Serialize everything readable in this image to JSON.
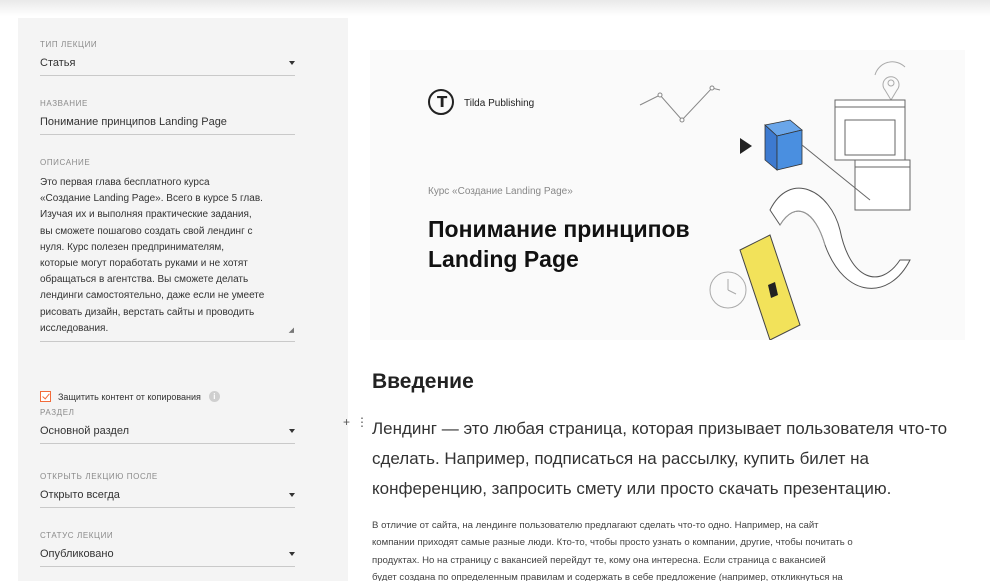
{
  "sidebar": {
    "lecture_type": {
      "label": "ТИП ЛЕКЦИИ",
      "value": "Статья"
    },
    "title_field": {
      "label": "НАЗВАНИЕ",
      "value": "Понимание принципов Landing Page"
    },
    "description": {
      "label": "ОПИСАНИЕ",
      "lines": [
        "Это первая глава бесплатного курса",
        "«Создание Landing Page». Всего в курсе 5 глав.",
        "Изучая их и выполняя практические задания,",
        "вы сможете пошагово создать свой лендинг с",
        "нуля. Курс полезен предпринимателям,",
        "которые могут поработать руками и не хотят",
        "обращаться в агентства. Вы сможете делать",
        "лендинги самостоятельно, даже если не умеете",
        "рисовать дизайн, верстать сайты и проводить",
        "исследования."
      ]
    },
    "protect_copy": {
      "label": "Защитить контент от копирования",
      "checked": true
    },
    "section": {
      "label": "РАЗДЕЛ",
      "value": "Основной раздел"
    },
    "open_after": {
      "label": "ОТКРЫТЬ ЛЕКЦИЮ ПОСЛЕ",
      "value": "Открыто всегда"
    },
    "status": {
      "label": "СТАТУС ЛЕКЦИИ",
      "value": "Опубликовано"
    }
  },
  "hero": {
    "logo_text": "Tilda Publishing",
    "subtitle": "Курс «Создание Landing Page»",
    "title_line1": "Понимание принципов",
    "title_line2": "Landing Page"
  },
  "content": {
    "heading": "Введение",
    "lead_lines": [
      "Лендинг — это любая страница, которая призывает пользователя что-то",
      "сделать. Например, подписаться на рассылку, купить билет на",
      "конференцию, запросить смету или просто скачать презентацию."
    ],
    "body_lines": [
      "В отличие от сайта, на лендинге пользователю предлагают сделать что-то одно. Например, на сайт",
      "компании приходят самые разные люди. Кто-то, чтобы просто узнать о компании, другие, чтобы почитать о",
      "продуктах. Но на страницу с вакансией перейдут те, кому она интересна. Если страница с вакансией",
      "будет создана по определенным правилам и содержать в себе предложение (например, откликнуться на"
    ]
  },
  "colors": {
    "accent": "#f26b3a",
    "cube_blue": "#4a8fe0",
    "panel_yellow": "#f2e25a"
  },
  "icons": [
    "chevron-down-icon",
    "check-icon",
    "info-icon",
    "tilda-logo-icon",
    "add-block-icon",
    "drag-handle-icon",
    "location-pin-icon",
    "clock-icon"
  ]
}
